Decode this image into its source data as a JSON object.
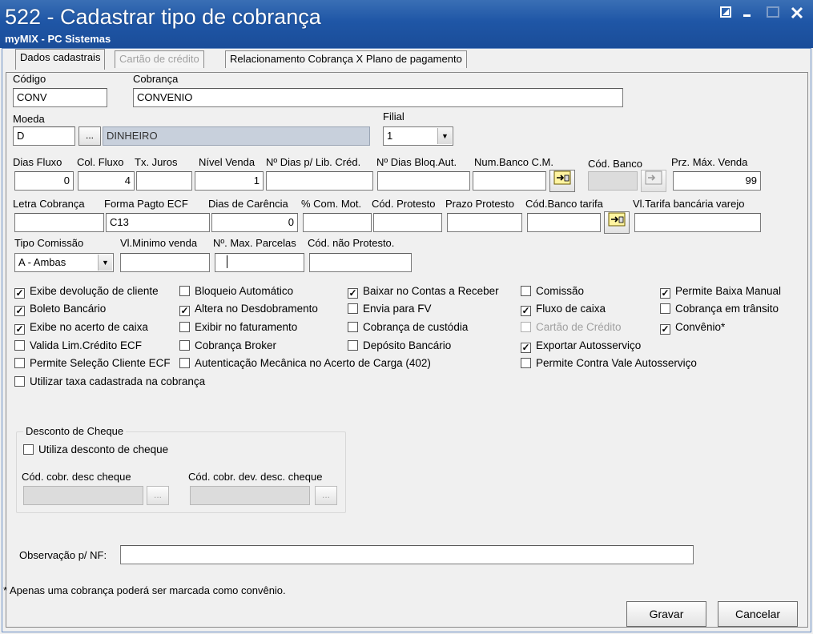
{
  "window": {
    "title": "522 - Cadastrar tipo de cobrança",
    "subtitle": "myMIX - PC Sistemas"
  },
  "tabs": [
    {
      "label": "Dados cadastrais",
      "active": true
    },
    {
      "label": "Cartão de crédito",
      "disabled": true
    },
    {
      "label": "Relacionamento Cobrança X Plano de pagamento"
    }
  ],
  "form": {
    "codigo": {
      "label": "Código",
      "value": "CONV"
    },
    "cobranca": {
      "label": "Cobrança",
      "value": "CONVENIO"
    },
    "moeda": {
      "label": "Moeda",
      "value": "D",
      "button": "...",
      "description": "DINHEIRO"
    },
    "filial": {
      "label": "Filial",
      "value": "1"
    },
    "dias_fluxo": {
      "label": "Dias Fluxo",
      "value": "0"
    },
    "col_fluxo": {
      "label": "Col. Fluxo",
      "value": "4"
    },
    "tx_juros": {
      "label": "Tx. Juros",
      "value": ""
    },
    "nivel_venda": {
      "label": "Nível Venda",
      "value": "1"
    },
    "dias_lib_cred": {
      "label": "Nº Dias p/ Lib. Créd.",
      "value": ""
    },
    "dias_bloq_aut": {
      "label": "Nº Dias Bloq.Aut.",
      "value": ""
    },
    "num_banco_cm": {
      "label": "Num.Banco C.M.",
      "value": ""
    },
    "cod_banco": {
      "label": "Cód. Banco",
      "value": ""
    },
    "prz_max_venda": {
      "label": "Prz. Máx. Venda",
      "value": "99"
    },
    "letra_cobranca": {
      "label": "Letra Cobrança",
      "value": ""
    },
    "forma_pagto_ecf": {
      "label": "Forma Pagto ECF",
      "value": "C13"
    },
    "dias_carencia": {
      "label": "Dias de Carência",
      "value": "0"
    },
    "com_mot": {
      "label": "% Com. Mot.",
      "value": ""
    },
    "cod_protesto": {
      "label": "Cód. Protesto",
      "value": ""
    },
    "prazo_protesto": {
      "label": "Prazo Protesto",
      "value": ""
    },
    "cod_banco_tarifa": {
      "label": "Cód.Banco tarifa",
      "value": ""
    },
    "vl_tarifa_bancaria": {
      "label": "Vl.Tarifa bancária varejo",
      "value": ""
    },
    "tipo_comissao": {
      "label": "Tipo Comissão",
      "value": "A - Ambas"
    },
    "vl_minimo_venda": {
      "label": "Vl.Minimo venda",
      "value": ""
    },
    "max_parcelas": {
      "label": "Nº. Max. Parcelas",
      "value": ""
    },
    "cod_nao_protesto": {
      "label": "Cód. não  Protesto.",
      "value": ""
    }
  },
  "checkboxes": [
    {
      "label": "Exibe devolução de cliente",
      "checked": true
    },
    {
      "label": "Bloqueio Automático",
      "checked": false
    },
    {
      "label": "Baixar no Contas a Receber",
      "checked": true
    },
    {
      "label": "Comissão",
      "checked": false
    },
    {
      "label": "Permite Baixa Manual",
      "checked": true
    },
    {
      "label": "Boleto Bancário",
      "checked": true
    },
    {
      "label": "Altera no Desdobramento",
      "checked": true
    },
    {
      "label": "Envia para FV",
      "checked": false
    },
    {
      "label": "Fluxo de caixa",
      "checked": true
    },
    {
      "label": "Cobrança em trânsito",
      "checked": false
    },
    {
      "label": "Exibe no acerto de caixa",
      "checked": true
    },
    {
      "label": "Exibir no faturamento",
      "checked": false
    },
    {
      "label": "Cobrança de custódia",
      "checked": false
    },
    {
      "label": "Cartão de Crédito",
      "checked": false,
      "disabled": true
    },
    {
      "label": "Convênio*",
      "checked": true
    },
    {
      "label": "Valida Lim.Crédito ECF",
      "checked": false
    },
    {
      "label": "Cobrança Broker",
      "checked": false
    },
    {
      "label": "Depósito Bancário",
      "checked": false
    },
    {
      "label": "Exportar Autosserviço",
      "checked": true
    },
    {
      "label": "Permite Seleção Cliente ECF",
      "checked": false
    },
    {
      "label": "Autenticação Mecânica no Acerto de Carga (402)",
      "checked": false
    },
    {
      "label": "Permite Contra Vale Autosserviço",
      "checked": false
    },
    {
      "label": "Utilizar taxa cadastrada na cobrança",
      "checked": false
    }
  ],
  "desconto_cheque": {
    "title": "Desconto de Cheque",
    "utiliza": {
      "label": "Utiliza desconto de cheque",
      "checked": false
    },
    "cod_cobr_desc": {
      "label": "Cód. cobr. desc cheque",
      "value": "",
      "button": "..."
    },
    "cod_cobr_dev_desc": {
      "label": "Cód. cobr. dev. desc. cheque",
      "value": "",
      "button": "..."
    }
  },
  "observacao": {
    "label": "Observação p/ NF:",
    "value": ""
  },
  "footnote": "* Apenas uma cobrança poderá ser marcada como convênio.",
  "buttons": {
    "gravar": "Gravar",
    "cancelar": "Cancelar"
  }
}
